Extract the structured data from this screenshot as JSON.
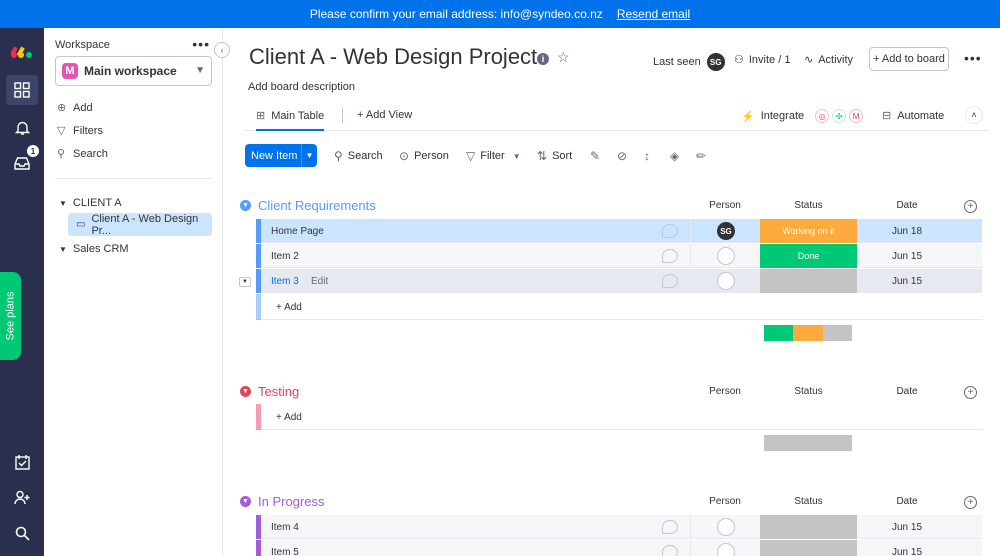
{
  "banner": {
    "text": "Please confirm your email address: info@syndeo.co.nz",
    "link": "Resend email"
  },
  "rail": {
    "notification_count": "1",
    "see_plans": "See plans"
  },
  "sidebar": {
    "workspace_label": "Workspace",
    "workspace_initial": "M",
    "workspace_name": "Main workspace",
    "actions": [
      "Add",
      "Filters",
      "Search"
    ],
    "folders": [
      {
        "label": "CLIENT A",
        "board": "Client A - Web Design Pr..."
      },
      {
        "label": "Sales CRM"
      }
    ]
  },
  "board": {
    "title": "Client A - Web Design Project",
    "description": "Add board description",
    "last_seen_label": "Last seen",
    "last_seen_initials": "SG",
    "invite": "Invite / 1",
    "activity": "Activity",
    "add_to_board": "+ Add to board"
  },
  "tabs": {
    "main_table": "Main Table",
    "add_view": "+ Add View",
    "integrate": "Integrate",
    "automate": "Automate"
  },
  "toolbar": {
    "new_item": "New Item",
    "search": "Search",
    "person": "Person",
    "filter": "Filter",
    "sort": "Sort"
  },
  "columns": {
    "person": "Person",
    "status": "Status",
    "date": "Date"
  },
  "groups": [
    {
      "title": "Client Requirements",
      "color": "#579bfc",
      "items": [
        {
          "name": "Home Page",
          "person": "SG",
          "status": "Working on it",
          "status_color": "#fdab3d",
          "date": "Jun 18"
        },
        {
          "name": "Item 2",
          "person": "",
          "status": "Done",
          "status_color": "#00c875",
          "date": "Jun 15"
        },
        {
          "name": "Item 3",
          "edit": "Edit",
          "person": "",
          "status": "",
          "status_color": "#c4c4c4",
          "date": "Jun 15"
        }
      ],
      "add_label": "+ Add"
    },
    {
      "title": "Testing",
      "color": "#e2445c",
      "add_label": "+ Add"
    },
    {
      "title": "In Progress",
      "color": "#a25ddc",
      "items": [
        {
          "name": "Item 4",
          "person": "",
          "status": "",
          "status_color": "#c4c4c4",
          "date": "Jun 15"
        },
        {
          "name": "Item 5",
          "person": "",
          "status": "",
          "status_color": "#c4c4c4",
          "date": "Jun 15"
        }
      ]
    }
  ]
}
